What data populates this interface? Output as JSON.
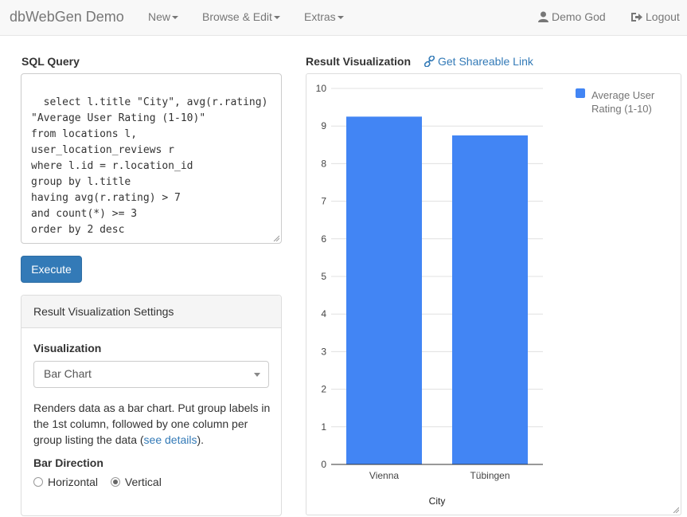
{
  "navbar": {
    "brand": "dbWebGen Demo",
    "menus": [
      {
        "label": "New"
      },
      {
        "label": "Browse & Edit"
      },
      {
        "label": "Extras"
      }
    ],
    "user": {
      "label": "Demo God",
      "icon": "user-icon"
    },
    "logout": {
      "label": "Logout",
      "icon": "logout-icon"
    }
  },
  "sql": {
    "title": "SQL Query",
    "query": "select l.title \"City\", avg(r.rating) \"Average User Rating (1-10)\"\nfrom locations l, user_location_reviews r\nwhere l.id = r.location_id\ngroup by l.title\nhaving avg(r.rating) > 7\nand count(*) >= 3\norder by 2 desc",
    "execute_label": "Execute"
  },
  "settings": {
    "heading": "Result Visualization Settings",
    "visualization_label": "Visualization",
    "visualization_value": "Bar Chart",
    "description_prefix": "Renders data as a bar chart. Put group labels in the 1st column, followed by one column per group listing the data (",
    "description_link": "see details",
    "description_suffix": ").",
    "bar_direction_label": "Bar Direction",
    "directions": [
      {
        "label": "Horizontal",
        "checked": false
      },
      {
        "label": "Vertical",
        "checked": true
      }
    ]
  },
  "result": {
    "title": "Result Visualization",
    "share_label": "Get Shareable Link",
    "share_icon": "link-icon"
  },
  "colors": {
    "accent": "#337ab7",
    "bar": "#4285f4"
  },
  "chart_data": {
    "type": "bar",
    "categories": [
      "Vienna",
      "Tübingen"
    ],
    "series": [
      {
        "name": "Average User Rating (1-10)",
        "values": [
          9.25,
          8.75
        ]
      }
    ],
    "xlabel": "City",
    "ylabel": "",
    "ylim": [
      0,
      10
    ],
    "yticks": [
      0,
      1,
      2,
      3,
      4,
      5,
      6,
      7,
      8,
      9,
      10
    ],
    "grid": true,
    "legend": "top-right"
  }
}
